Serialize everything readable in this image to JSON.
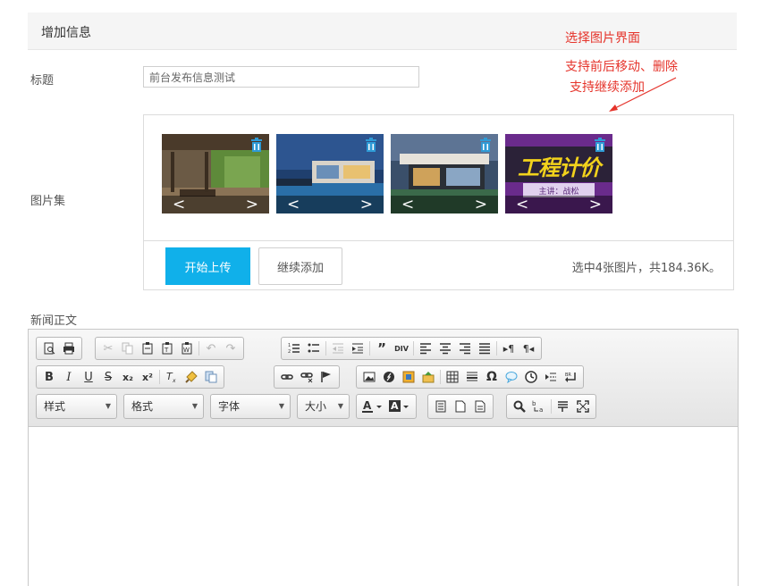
{
  "header": {
    "title": "增加信息"
  },
  "annotations": {
    "line1": "选择图片界面",
    "line2": "支持前后移动、删除",
    "line3": "支持继续添加",
    "color": "#e5332a"
  },
  "form": {
    "title_label": "标题",
    "title_value": "前台发布信息测试",
    "gallery_label": "图片集",
    "body_label": "新闻正文"
  },
  "gallery": {
    "thumbnails": [
      {
        "name": "patio-photo",
        "prev": "<",
        "next": ">"
      },
      {
        "name": "villa-pool-photo",
        "prev": "<",
        "next": ">"
      },
      {
        "name": "modern-house-photo",
        "prev": "<",
        "next": ">"
      },
      {
        "name": "course-banner",
        "prev": "<",
        "next": ">",
        "banner_title": "工程计价",
        "banner_subtitle": "主讲：战松"
      }
    ],
    "upload_button": "开始上传",
    "continue_button": "继续添加",
    "status": "选中4张图片，共184.36K。",
    "accent": "#10b0ea"
  },
  "editor": {
    "combos": {
      "style": "样式",
      "format": "格式",
      "font": "字体",
      "size": "大小"
    },
    "format_buttons": {
      "bold": "B",
      "italic": "I",
      "underline": "U",
      "strike": "S",
      "subscript": "x₂",
      "superscript": "x²",
      "special_char": "Ω"
    }
  }
}
